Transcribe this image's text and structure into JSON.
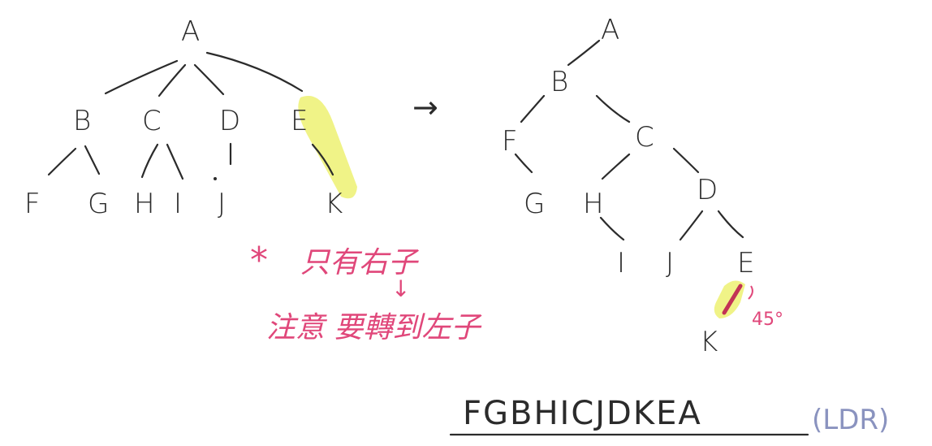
{
  "left_tree": {
    "nodes": {
      "A": "A",
      "B": "B",
      "C": "C",
      "D": "D",
      "E": "E",
      "F": "F",
      "G": "G",
      "H": "H",
      "I": "I",
      "J": "J",
      "K": "K"
    }
  },
  "right_tree": {
    "nodes": {
      "A": "A",
      "B": "B",
      "C": "C",
      "D": "D",
      "E": "E",
      "F": "F",
      "G": "G",
      "H": "H",
      "I": "I",
      "J": "J",
      "K": "K"
    },
    "angle_note": "45°"
  },
  "arrow": "→",
  "note": {
    "star": "*",
    "line1": "只有右子",
    "down_arrow": "↓",
    "line2": "注意 要轉到左子"
  },
  "traversal": {
    "sequence": "FGBHICJDKEA",
    "order": "(LDR)"
  },
  "colors": {
    "ink": "#2b2b2b",
    "highlight": "#eef27a",
    "note_pink": "#e0477a",
    "order_blue": "#8a93bf",
    "red_marker": "#c23355"
  }
}
